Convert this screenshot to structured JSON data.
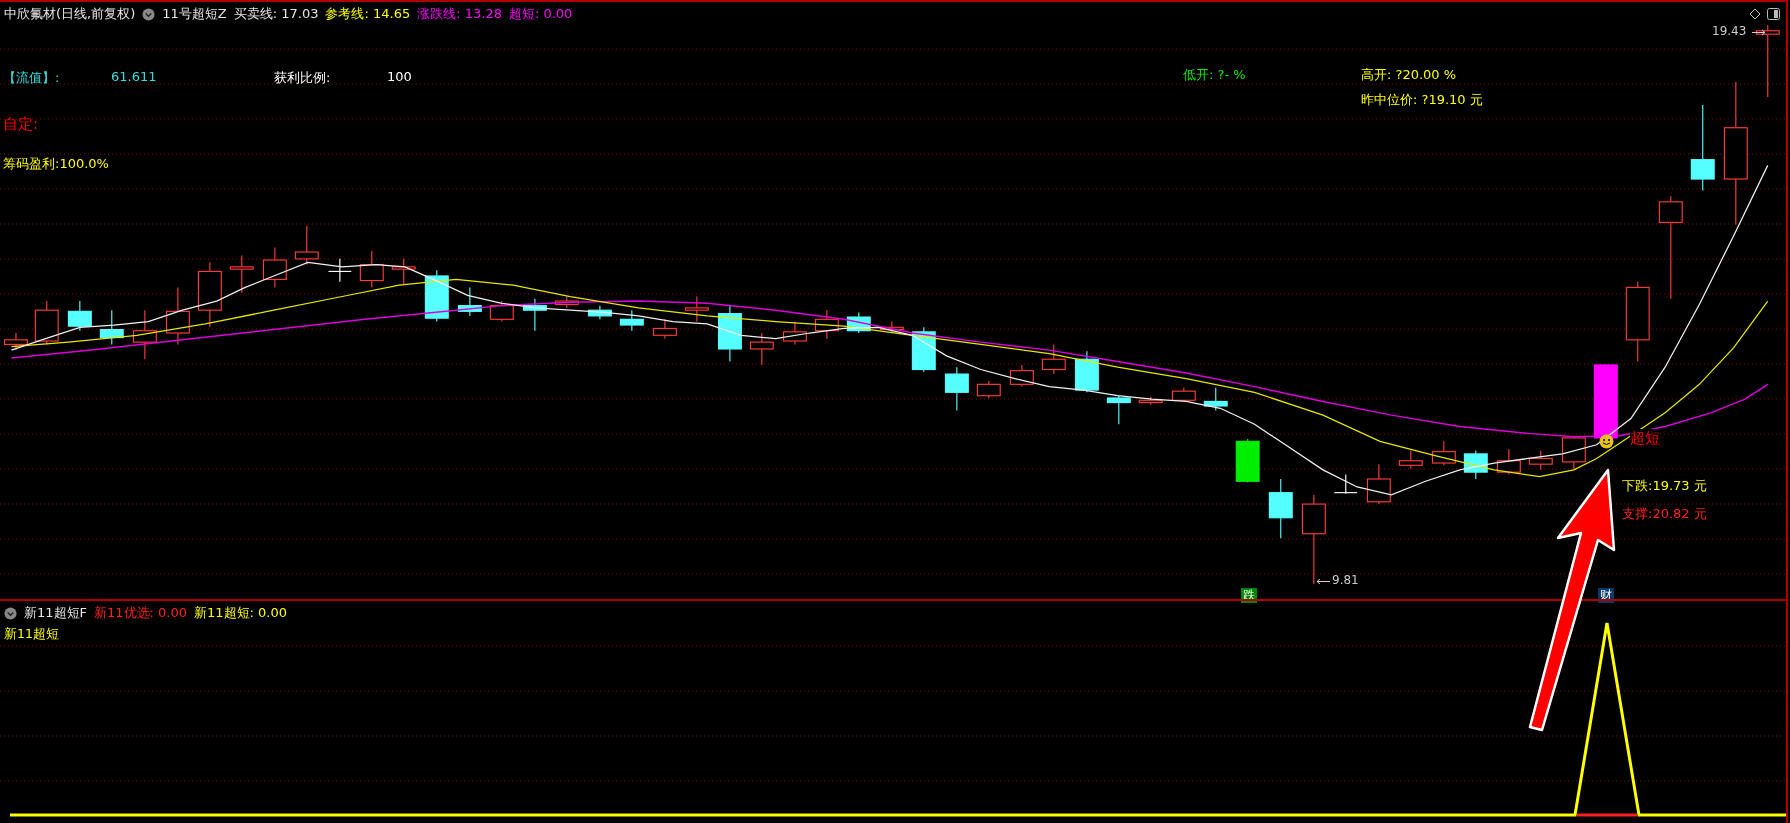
{
  "header": {
    "symbol": "中欣氟材(日线,前复权)",
    "indicator": "11号超短Z",
    "values": [
      {
        "text": "买卖线: 17.03",
        "color": "#e6e6e6"
      },
      {
        "text": "参考线: 14.65",
        "color": "#ffff00"
      },
      {
        "text": "涨跌线: 13.28",
        "color": "#ff00ff"
      },
      {
        "text": "超短: 0.00",
        "color": "#ff00ff"
      }
    ]
  },
  "overlay_labels": [
    {
      "text": "【流值】:",
      "color": "#33dddd"
    },
    {
      "text": "61.611",
      "color": "#33dddd"
    },
    {
      "text": "获利比例:",
      "color": "#ffffff"
    },
    {
      "text": "100",
      "color": "#ffffff"
    },
    {
      "text": "自定:",
      "color": "#ff0000"
    },
    {
      "text": "筹码盈利:100.0%",
      "color": "#ffff00"
    },
    {
      "text": "低开: ?- %",
      "color": "#00ee00"
    },
    {
      "text": "高开: ?20.00 %",
      "color": "#ffff00"
    },
    {
      "text": "昨中位价: ?19.10 元",
      "color": "#ffff00"
    }
  ],
  "price_marks": {
    "high": "19.43",
    "low": "9.81"
  },
  "signal_labels": [
    {
      "text": "超短",
      "color": "#ff0000"
    },
    {
      "text": "下跌:19.73 元",
      "color": "#ffff00"
    },
    {
      "text": "支撑:20.82 元",
      "color": "#ff2020"
    }
  ],
  "markers": [
    {
      "text": "跌",
      "color": "#008800"
    },
    {
      "text": "财",
      "color": "#0a3a6a"
    }
  ],
  "lower_panel": {
    "indicator": "新11超短F",
    "values": [
      {
        "text": "新11优选: 0.00",
        "color": "#ff2020"
      },
      {
        "text": "新11超短: 0.00",
        "color": "#ffff00"
      }
    ],
    "label": "新11超短"
  }
}
